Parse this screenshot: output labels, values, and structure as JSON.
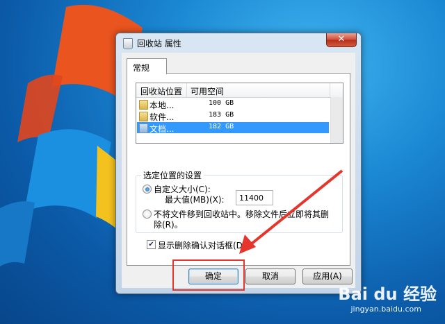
{
  "window": {
    "title": "回收站 属性",
    "close_glyph": "✕"
  },
  "tabs": [
    {
      "label": "常规"
    }
  ],
  "list": {
    "columns": [
      "回收站位置",
      "可用空间"
    ],
    "rows": [
      {
        "name": "本地...",
        "space": "100 GB",
        "selected": false
      },
      {
        "name": "软件...",
        "space": "183 GB",
        "selected": false
      },
      {
        "name": "文档...",
        "space": "182 GB",
        "selected": true
      }
    ]
  },
  "settings": {
    "group_title": "选定位置的设置",
    "custom_size_label": "自定义大小(C):",
    "max_label": "最大值(MB)(X):",
    "max_value": "11400",
    "no_move_label_line1": "不将文件移到回收站中。移除文件后立即将其删",
    "no_move_label_line2": "除(R)。",
    "custom_selected": true
  },
  "confirm": {
    "label": "显示删除确认对话框(D)",
    "checked": true,
    "check_glyph": "✔"
  },
  "buttons": {
    "ok": "确定",
    "cancel": "取消",
    "apply": "应用(A)"
  },
  "watermark": {
    "brand": "Bai du 经验",
    "url": "jingyan.baidu.com"
  },
  "colors": {
    "selection": "#3399ff",
    "annotation": "#e5352c",
    "desktop": "#1a86d2"
  }
}
